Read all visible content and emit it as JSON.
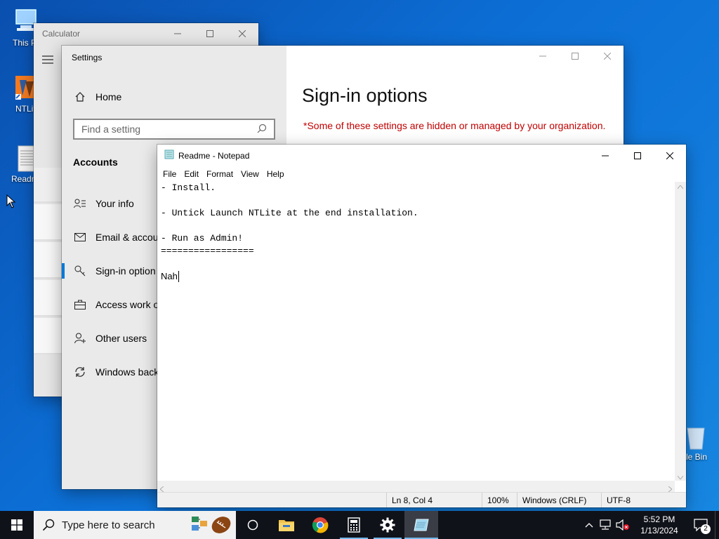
{
  "desktop": {
    "icons": [
      {
        "label": "This P"
      },
      {
        "label": "NTLit"
      },
      {
        "label": "Readm"
      },
      {
        "label": "le Bin"
      }
    ]
  },
  "calculator": {
    "title": "Calculator"
  },
  "settings": {
    "title": "Settings",
    "home_label": "Home",
    "search_placeholder": "Find a setting",
    "section_title": "Accounts",
    "nav_items": [
      {
        "label": "Your info"
      },
      {
        "label": "Email & accour"
      },
      {
        "label": "Sign-in option"
      },
      {
        "label": "Access work o"
      },
      {
        "label": "Other users"
      },
      {
        "label": "Windows back"
      }
    ],
    "page_title": "Sign-in options",
    "managed_note": "*Some of these settings are hidden or managed by your organization."
  },
  "notepad": {
    "title": "Readme - Notepad",
    "menu": [
      "File",
      "Edit",
      "Format",
      "View",
      "Help"
    ],
    "lines": [
      "- Install.",
      "",
      "- Untick Launch NTLite at the end installation.",
      "",
      "- Run as Admin!",
      "=================",
      "",
      "Nah"
    ],
    "status": {
      "position": "Ln 8, Col 4",
      "zoom": "100%",
      "line_endings": "Windows (CRLF)",
      "encoding": "UTF-8"
    }
  },
  "taskbar": {
    "search_placeholder": "Type here to search",
    "time": "5:52 PM",
    "date": "1/13/2024",
    "notification_count": "2"
  },
  "colors": {
    "accent": "#0078d7",
    "managed_note": "#c00000",
    "taskbar": "#10121a"
  }
}
